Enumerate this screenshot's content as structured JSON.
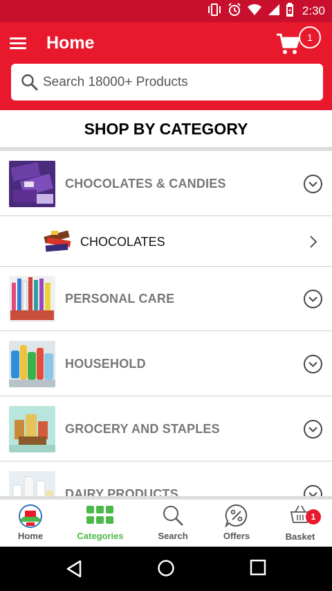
{
  "status_bar": {
    "time": "2:30",
    "icons": [
      "vibrate-icon",
      "alarm-icon",
      "wifi-icon",
      "signal-icon",
      "battery-icon"
    ]
  },
  "app_bar": {
    "title": "Home",
    "cart_count": "1",
    "search_placeholder": "Search 18000+ Products"
  },
  "section": {
    "title": "SHOP BY CATEGORY"
  },
  "categories": [
    {
      "label": "CHOCOLATES & CANDIES",
      "expanded": true,
      "thumb": "chocolates-thumb"
    },
    {
      "label": "CHOCOLATES",
      "sub": true,
      "thumb": "chocolate-bars-thumb"
    },
    {
      "label": "PERSONAL CARE",
      "thumb": "personal-care-thumb"
    },
    {
      "label": "HOUSEHOLD",
      "thumb": "household-thumb"
    },
    {
      "label": "GROCERY AND STAPLES",
      "thumb": "grocery-thumb"
    },
    {
      "label": "DAIRY PRODUCTS",
      "thumb": "dairy-thumb"
    }
  ],
  "bottom_nav": {
    "items": [
      {
        "label": "Home",
        "icon": "store-logo-icon",
        "active": false
      },
      {
        "label": "Categories",
        "icon": "grid-icon",
        "active": true
      },
      {
        "label": "Search",
        "icon": "search-icon",
        "active": false
      },
      {
        "label": "Offers",
        "icon": "percent-icon",
        "active": false
      },
      {
        "label": "Basket",
        "icon": "basket-icon",
        "active": false
      }
    ],
    "basket_count": "1"
  },
  "colors": {
    "status_bar": "#c8102e",
    "app_bar": "#e8192c",
    "active_nav": "#4cb848"
  }
}
